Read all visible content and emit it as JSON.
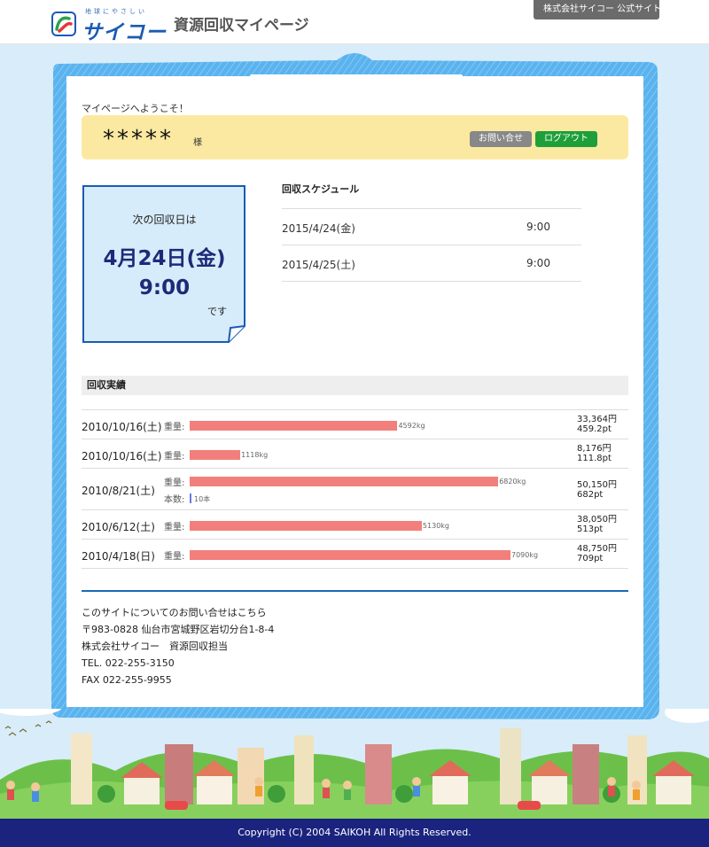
{
  "header": {
    "logo_tag": "地球にやさしい",
    "logo_text": "サイコー",
    "site_title": "資源回収マイページ",
    "corp_link": "株式会社サイコー 公式サイト ›"
  },
  "welcome": "マイページへようこそ！",
  "user": {
    "name": "*****",
    "suffix": "様",
    "contact_button": "お問い合せ",
    "logout_button": "ログアウト"
  },
  "next_collection": {
    "label": "次の回収日は",
    "date": "4月24日(金)",
    "time": "9:00",
    "suffix": "です"
  },
  "schedule": {
    "title": "回収スケジュール",
    "rows": [
      {
        "date": "2015/4/24(金)",
        "time": "9:00"
      },
      {
        "date": "2015/4/25(土)",
        "time": "9:00"
      }
    ]
  },
  "results": {
    "title": "回収実績",
    "weight_label": "重量:",
    "count_label": "本数:",
    "rows": [
      {
        "date": "2010/10/16(土)",
        "weight": 4592,
        "weight_text": "4592kg",
        "yen": "33,364円",
        "pt": "459.2pt"
      },
      {
        "date": "2010/10/16(土)",
        "weight": 1118,
        "weight_text": "1118kg",
        "yen": "8,176円",
        "pt": "111.8pt"
      },
      {
        "date": "2010/8/21(土)",
        "weight": 6820,
        "weight_text": "6820kg",
        "count": 10,
        "count_text": "10本",
        "yen": "50,150円",
        "pt": "682pt"
      },
      {
        "date": "2010/6/12(土)",
        "weight": 5130,
        "weight_text": "5130kg",
        "yen": "38,050円",
        "pt": "513pt"
      },
      {
        "date": "2010/4/18(日)",
        "weight": 7090,
        "weight_text": "7090kg",
        "yen": "48,750円",
        "pt": "709pt"
      }
    ]
  },
  "contact": {
    "line1": "このサイトについてのお問い合せはこちら",
    "line2": "〒983-0828 仙台市宮城野区岩切分台1-8-4",
    "line3": "株式会社サイコー　資源回収担当",
    "line4": "TEL. 022-255-3150",
    "line5": "FAX 022-255-9955"
  },
  "footer": {
    "copyright": "Copyright (C) 2004 SAIKOH All Rights Reserved."
  },
  "colors": {
    "frame": "#5ab3ee",
    "user_bar": "#fbe9a2",
    "logout": "#1f9f3a",
    "bar_weight": "#f27f7c",
    "bar_count": "#6e77e6",
    "title_blue": "#1e2a78",
    "footer_bg": "#1a237e"
  }
}
